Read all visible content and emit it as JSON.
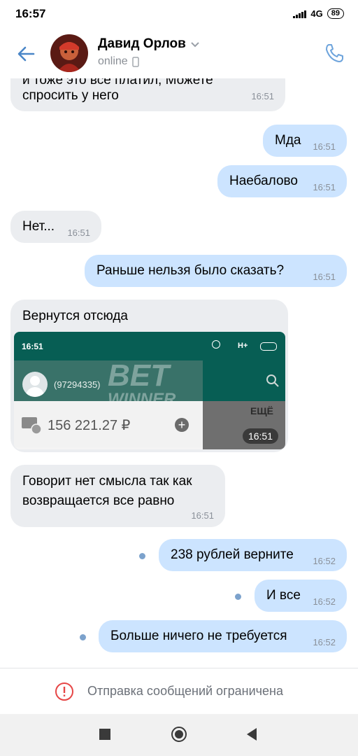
{
  "status_bar": {
    "time": "16:57",
    "network": "4G",
    "battery": "89"
  },
  "header": {
    "contact_name": "Давид Орлов",
    "status": "online"
  },
  "messages": [
    {
      "dir": "in",
      "lines": [
        "и тоже это все платил, Можете",
        "спросить у него"
      ],
      "time": "16:51"
    },
    {
      "dir": "out",
      "text": "Мда",
      "time": "16:51"
    },
    {
      "dir": "out",
      "text": "Наебалово",
      "time": "16:51"
    },
    {
      "dir": "in",
      "text": "Нет...",
      "time": "16:51"
    },
    {
      "dir": "out",
      "text": "Раньше нельзя было сказать?",
      "time": "16:51"
    },
    {
      "dir": "in",
      "text": "Вернутся отсюда",
      "time": "16:51",
      "attachment": {
        "status_time": "16:51",
        "network": "H+",
        "account": "(97294335)",
        "watermark_top": "BET",
        "watermark_bottom": "WINNER",
        "balance": "156 221.27 ₽",
        "side_label": "ЕЩЁ"
      }
    },
    {
      "dir": "in",
      "lines": [
        "Говорит нет смысла так как",
        "возвращается все равно"
      ],
      "time": "16:51"
    },
    {
      "dir": "out",
      "text": "238 рублей верните",
      "time": "16:52"
    },
    {
      "dir": "out",
      "text": "И все",
      "time": "16:52"
    },
    {
      "dir": "out",
      "text": "Больше ничего не требуется",
      "time": "16:52"
    }
  ],
  "restriction": {
    "text": "Отправка сообщений ограничена"
  },
  "colors": {
    "accent": "#4a86c7",
    "incoming": "#ebedf0",
    "outgoing": "#cce4ff",
    "error": "#e64646"
  }
}
